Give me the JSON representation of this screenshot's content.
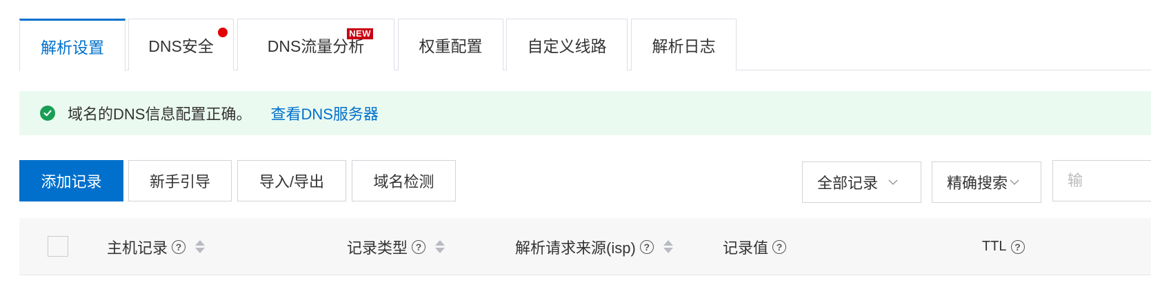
{
  "tabs": [
    {
      "label": "解析设置",
      "active": true
    },
    {
      "label": "DNS安全",
      "badge": "dot"
    },
    {
      "label": "DNS流量分析",
      "badge": "NEW"
    },
    {
      "label": "权重配置"
    },
    {
      "label": "自定义线路"
    },
    {
      "label": "解析日志"
    }
  ],
  "alert": {
    "message": "域名的DNS信息配置正确。",
    "link": "查看DNS服务器",
    "icon": "check-circle-icon",
    "color": "#1a9e55"
  },
  "toolbar": {
    "add_record": "添加记录",
    "guide": "新手引导",
    "import_export": "导入/导出",
    "domain_check": "域名检测",
    "filter_select": "全部记录",
    "search_mode": "精确搜索",
    "search_placeholder": "输"
  },
  "table": {
    "columns": {
      "host": "主机记录",
      "type": "记录类型",
      "isp": "解析请求来源(isp)",
      "value": "记录值",
      "ttl": "TTL"
    }
  },
  "colors": {
    "accent": "#0070cc",
    "badge_red": "#c80012",
    "alert_bg": "#ebfaf0"
  }
}
